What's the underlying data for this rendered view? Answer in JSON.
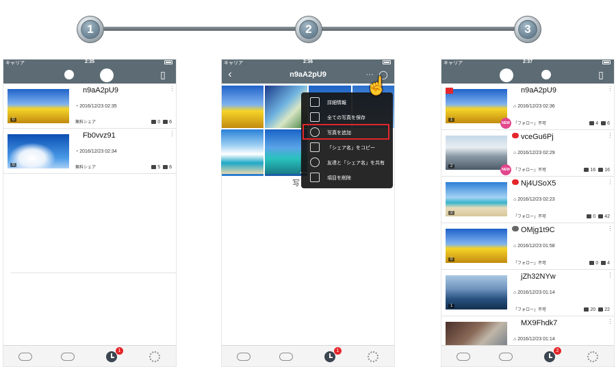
{
  "steps": [
    "1",
    "2",
    "3"
  ],
  "screen1": {
    "carrier": "キャリア",
    "time": "2:35",
    "rows": [
      {
        "title": "n9aA2pU9",
        "date": "2016/12/23  02:35",
        "share": "無料シェア",
        "videos": "0",
        "photos": "6",
        "count": "0"
      },
      {
        "title": "Fb0vvz91",
        "date": "2016/12/23  02:34",
        "share": "無料シェア",
        "videos": "5",
        "photos": "6",
        "count": "0"
      }
    ],
    "tab_badge": "1"
  },
  "screen2": {
    "carrier": "キャリア",
    "time": "2:36",
    "title": "n9aA2pU9",
    "more": "···",
    "below_text": "写",
    "menu": [
      {
        "label": "詳細情報",
        "icon": "list-icon"
      },
      {
        "label": "全ての写真を保存",
        "icon": "save-icon"
      },
      {
        "label": "写真を追加",
        "icon": "add-icon"
      },
      {
        "label": "「シェア名」をコピー",
        "icon": "copy-icon"
      },
      {
        "label": "友達と「シェア名」を共有",
        "icon": "share-icon"
      },
      {
        "label": "項目を削除",
        "icon": "trash-icon"
      }
    ],
    "tab_badge": "1"
  },
  "screen3": {
    "carrier": "キャリア",
    "time": "2:37",
    "rows": [
      {
        "title": "n9aA2pU9",
        "date": "2016/12/23  02:36",
        "share": "「フォロー」不可",
        "videos": "4",
        "photos": "6",
        "count": "1",
        "new": "NEW"
      },
      {
        "title": "vceGu6Pj",
        "date": "2016/12/23  02:29",
        "share": "「フォロー」不可",
        "videos": "16",
        "photos": "16",
        "count": "2",
        "new": "NEW"
      },
      {
        "title": "Nj4USoX5",
        "date": "2016/12/23  02:23",
        "share": "「フォロー」不可",
        "videos": "0",
        "photos": "42",
        "count": "2"
      },
      {
        "title": "OMjg1t9C",
        "date": "2016/12/23  01:58",
        "share": "「フォロー」不可",
        "videos": "0",
        "photos": "4",
        "count": "0"
      },
      {
        "title": "jZh32NYw",
        "date": "2016/12/23  01:14",
        "share": "「フォロー」不可",
        "videos": "20",
        "photos": "22",
        "count": "1"
      },
      {
        "title": "MX9Fhdk7",
        "date": "2016/12/23  01:14",
        "share": "",
        "videos": "",
        "photos": "",
        "count": ""
      }
    ],
    "tab_badge": "2"
  }
}
